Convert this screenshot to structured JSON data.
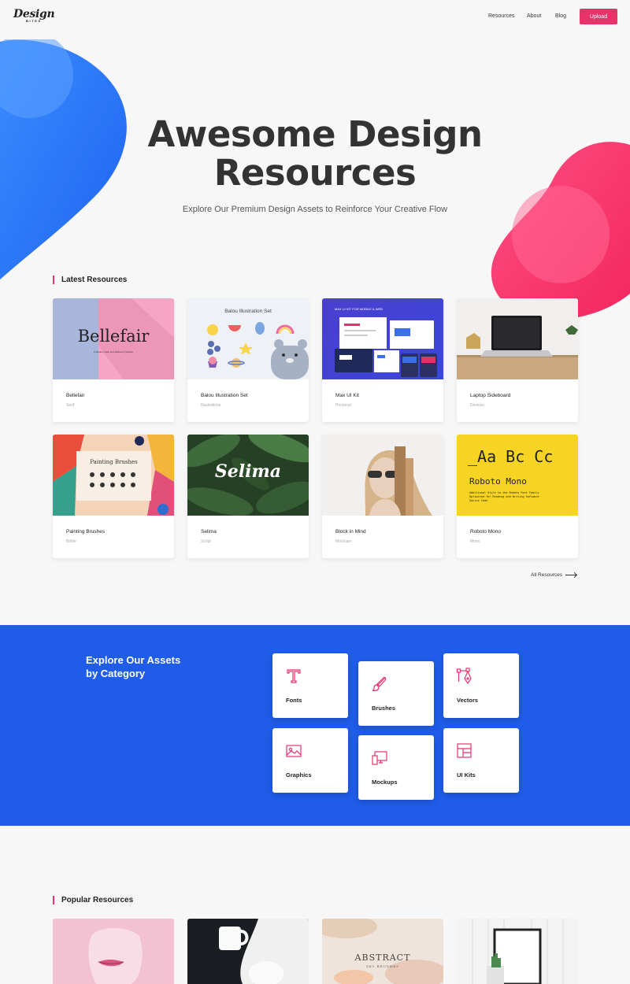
{
  "header": {
    "logo_main": "Design",
    "logo_sub": "BITES",
    "nav": [
      "Resources",
      "About",
      "Blog"
    ],
    "upload_label": "Upload"
  },
  "hero": {
    "title_line1": "Awesome Design",
    "title_line2": "Resources",
    "subtitle": "Explore Our Premium Design Assets to Reinforce Your Creative Flow"
  },
  "latest": {
    "title": "Latest Resources",
    "cards": [
      {
        "name": "Bellefair",
        "category": "Serif",
        "thumb_text": "Bellefair",
        "thumb_caption": "A Modern Latin and Hebrew Typeface"
      },
      {
        "name": "Balou Illustration Set",
        "category": "Illustrations",
        "thumb_text": "Balou Illustration Set"
      },
      {
        "name": "Max UI Kit",
        "category": "Personal",
        "thumb_text": "MAX UI KIT FOR MOBILE & WEB"
      },
      {
        "name": "Laptop Sideboard",
        "category": "Devices"
      },
      {
        "name": "Painting Brushes",
        "category": "Brittle",
        "thumb_text": "Painting Brushes"
      },
      {
        "name": "Selima",
        "category": "Script",
        "thumb_text": "Selima"
      },
      {
        "name": "Block in Mind",
        "category": "Mockups"
      },
      {
        "name": "Roboto Mono",
        "category": "Mono",
        "thumb_text": "_Aa Bc Cc",
        "thumb_title": "Roboto Mono",
        "thumb_body": "Additional Style to the Roboto Font Family Optimized for Reading and Writing Software Source Code"
      }
    ],
    "all_label": "All Resources"
  },
  "categories": {
    "title_line1": "Explore Our Assets",
    "title_line2": "by Category",
    "items": [
      {
        "label": "Fonts",
        "icon": "type-icon"
      },
      {
        "label": "Brushes",
        "icon": "brush-icon"
      },
      {
        "label": "Vectors",
        "icon": "vector-pen-icon"
      },
      {
        "label": "Graphics",
        "icon": "image-icon"
      },
      {
        "label": "Mockups",
        "icon": "devices-icon"
      },
      {
        "label": "UI Kits",
        "icon": "layout-icon"
      }
    ]
  },
  "popular": {
    "title": "Popular Resources",
    "cards": [
      {
        "thumb_text": ""
      },
      {
        "thumb_text": ""
      },
      {
        "thumb_text": "ABSTRACT",
        "thumb_sub": "SKY BRUSHES"
      },
      {
        "thumb_text": ""
      }
    ]
  },
  "colors": {
    "accent": "#e8326a",
    "band": "#1f5ce8",
    "blob_blue": "#2a7bf5",
    "blob_pink": "#ff3d78"
  }
}
